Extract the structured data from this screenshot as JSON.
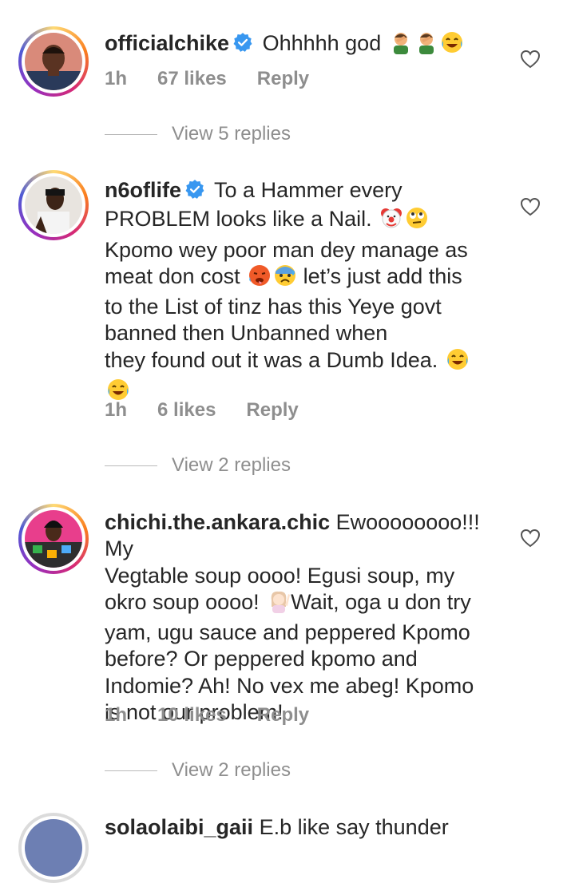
{
  "comments": [
    {
      "username": "officialchike",
      "verified": true,
      "text": "Ohhhhh god",
      "emojis": [
        "facepalm-man",
        "facepalm-man",
        "tears-of-joy"
      ],
      "time": "1h",
      "likes": "67 likes",
      "reply": "Reply",
      "view_replies": "View 5 replies"
    },
    {
      "username": "n6oflife",
      "verified": true,
      "lines": [
        "To a Hammer every",
        "PROBLEM looks like a Nail.",
        "Kpomo wey poor man dey manage as",
        "meat don cost",
        "let’s just add this",
        "to the List of tinz has this Yeye govt",
        "banned then Unbanned when",
        "they found out it was a Dumb Idea."
      ],
      "time": "1h",
      "likes": "6 likes",
      "reply": "Reply",
      "view_replies": "View 2 replies"
    },
    {
      "username": "chichi.the.ankara.chic",
      "verified": false,
      "lines": [
        "Ewoooooooo!!! My",
        "Vegtable soup oooo! Egusi soup, my",
        "okro soup oooo!",
        "Wait, oga u don try",
        "yam, ugu sauce and peppered Kpomo",
        "before? Or peppered kpomo and",
        "Indomie? Ah! No vex me abeg! Kpomo",
        "is not our problem!"
      ],
      "time": "1h",
      "likes": "10 likes",
      "reply": "Reply",
      "view_replies": "View 2 replies"
    },
    {
      "username": "solaolaibi_gaii",
      "text": "E.b like say thunder"
    }
  ],
  "colors": {
    "verified_blue": "#3897f0",
    "meta_gray": "#8e8e8e",
    "text": "#262626"
  }
}
